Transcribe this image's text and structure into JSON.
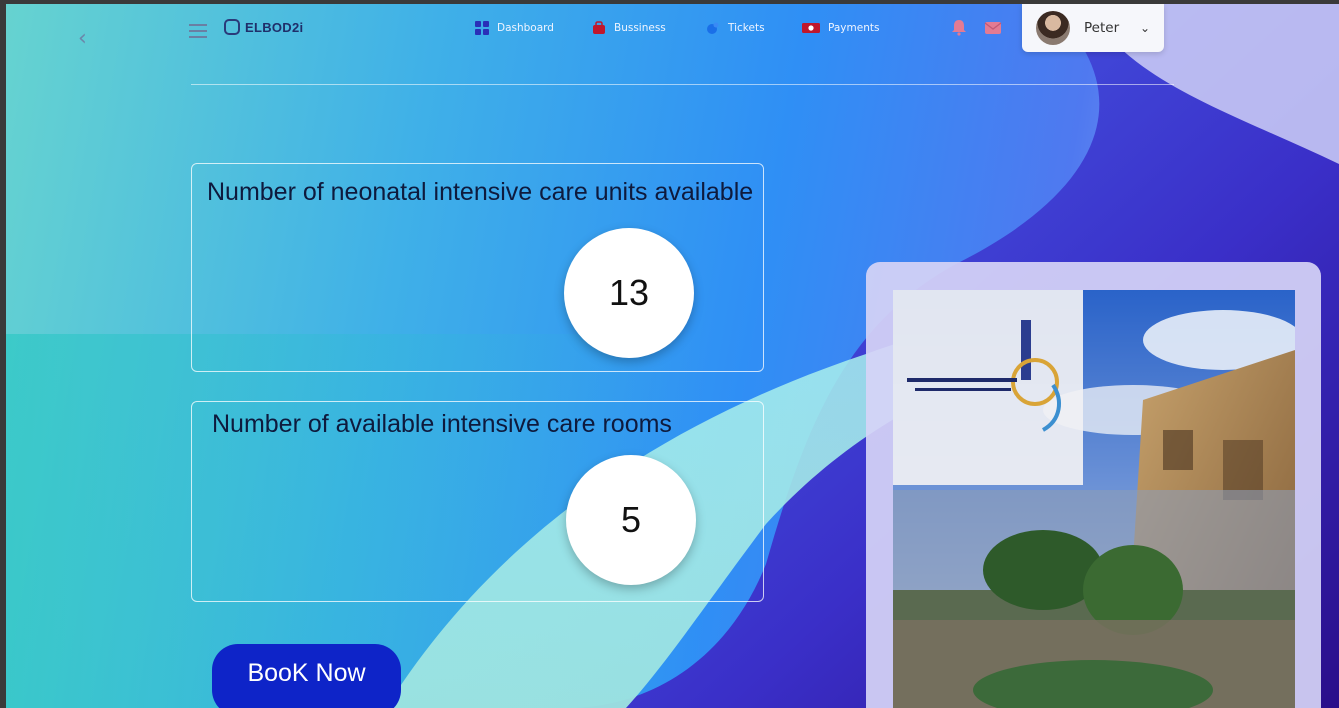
{
  "header": {
    "logo_text": "ELBOD2i",
    "nav": [
      {
        "label": "Dashboard",
        "icon": "dashboard-grid-icon",
        "color": "#2a2fb8"
      },
      {
        "label": "Bussiness",
        "icon": "briefcase-icon",
        "color": "#c0172c"
      },
      {
        "label": "Tickets",
        "icon": "ticket-icon",
        "color": "#1a6fe8"
      },
      {
        "label": "Payments",
        "icon": "money-icon",
        "color": "#c0172c"
      }
    ],
    "user": {
      "name": "Peter"
    }
  },
  "cards": [
    {
      "title": "Number of neonatal intensive care units available",
      "value": "13"
    },
    {
      "title": "Number of available intensive care rooms",
      "value": "5"
    }
  ],
  "book_button": "BooK Now",
  "colors": {
    "accent": "#0e24c8",
    "card_border": "#ffffff"
  }
}
